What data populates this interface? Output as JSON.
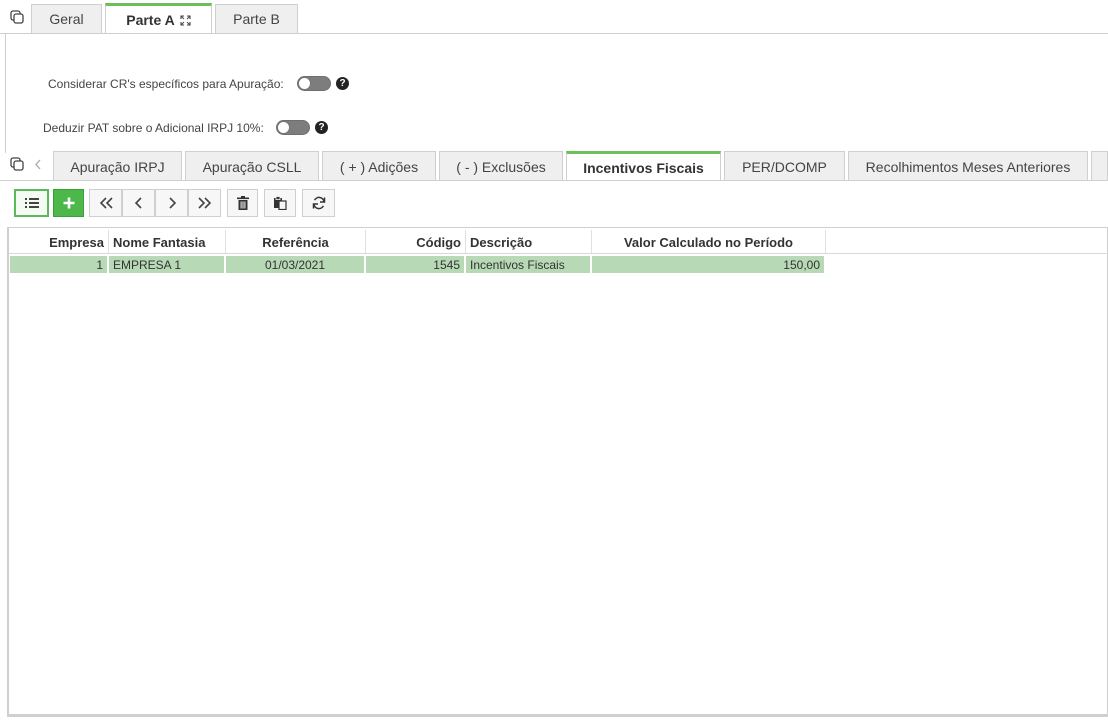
{
  "top_tabs": [
    {
      "label": "Geral",
      "active": false
    },
    {
      "label": "Parte A",
      "active": true
    },
    {
      "label": "Parte B",
      "active": false
    }
  ],
  "options": {
    "cr_label": "Considerar CR's específicos para Apuração:",
    "pat_label": "Deduzir PAT sobre o Adicional IRPJ 10%:",
    "help_glyph": "?"
  },
  "sub_tabs": [
    {
      "label": "Apuração IRPJ",
      "active": false
    },
    {
      "label": "Apuração CSLL",
      "active": false
    },
    {
      "label": "( + ) Adições",
      "active": false
    },
    {
      "label": "( - ) Exclusões",
      "active": false
    },
    {
      "label": "Incentivos Fiscais",
      "active": true
    },
    {
      "label": "PER/DCOMP",
      "active": false
    },
    {
      "label": "Recolhimentos Meses Anteriores",
      "active": false
    }
  ],
  "grid": {
    "columns": [
      "Empresa",
      "Nome Fantasia",
      "Referência",
      "Código",
      "Descrição",
      "Valor Calculado no Período"
    ],
    "rows": [
      {
        "empresa": "1",
        "nome_fantasia": "EMPRESA 1",
        "referencia": "01/03/2021",
        "codigo": "1545",
        "descricao": "Incentivos Fiscais",
        "valor": "150,00"
      }
    ]
  },
  "colors": {
    "accent": "#6cc05c",
    "row_selected": "#b8d9b6",
    "add_button": "#4cb84a"
  }
}
